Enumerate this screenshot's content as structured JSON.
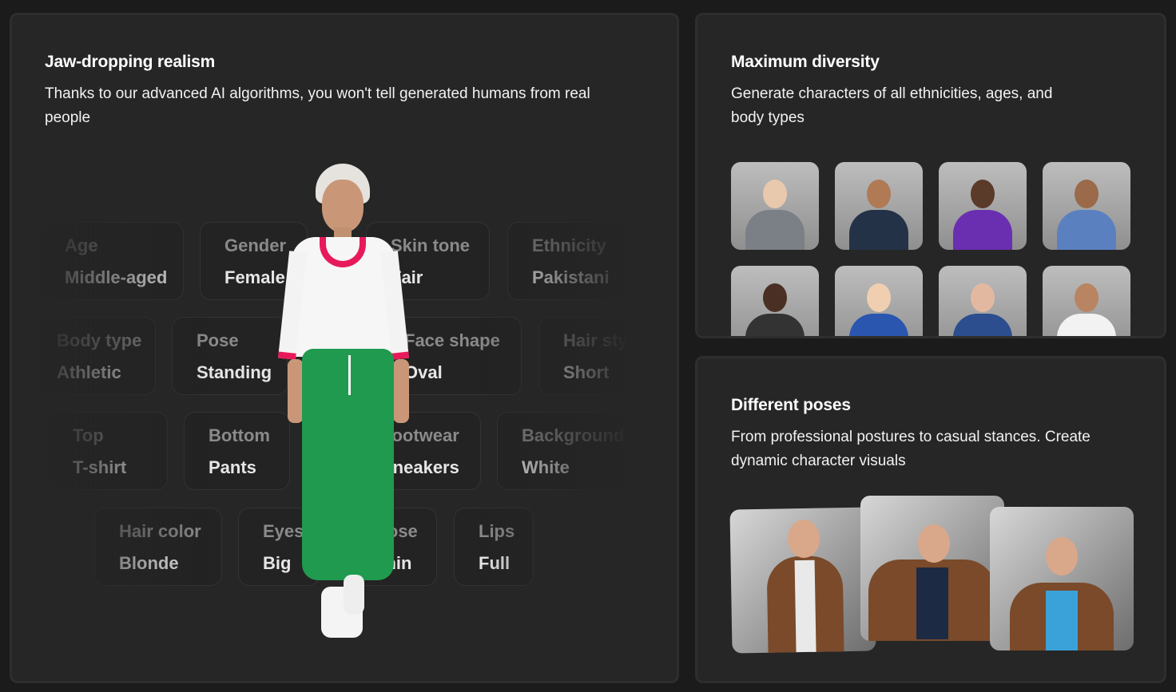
{
  "realism": {
    "title": "Jaw-dropping realism",
    "description": "Thanks to our advanced AI algorithms, you won't tell generated humans from real people",
    "chips": [
      {
        "key": "Age",
        "value": "Middle-aged"
      },
      {
        "key": "Gender",
        "value": "Female"
      },
      {
        "key": "Skin tone",
        "value": "Fair"
      },
      {
        "key": "Ethnicity",
        "value": "Pakistani"
      },
      {
        "key": "Body type",
        "value": "Athletic"
      },
      {
        "key": "Pose",
        "value": "Standing"
      },
      {
        "key": "Face shape",
        "value": "Oval"
      },
      {
        "key": "Hair style",
        "value": "Short"
      },
      {
        "key": "Top",
        "value": "T-shirt"
      },
      {
        "key": "Bottom",
        "value": "Pants"
      },
      {
        "key": "Footwear",
        "value": "Sneakers"
      },
      {
        "key": "Background",
        "value": "White"
      },
      {
        "key": "Hair color",
        "value": "Blonde"
      },
      {
        "key": "Eyes",
        "value": "Big"
      },
      {
        "key": "Nose",
        "value": "Thin"
      },
      {
        "key": "Lips",
        "value": "Full"
      }
    ]
  },
  "diversity": {
    "title": "Maximum diversity",
    "description": "Generate characters of all ethnicities, ages, and body types",
    "portraits": [
      {
        "skin": "#e8c9ad",
        "top": "#7b7f86"
      },
      {
        "skin": "#b07a55",
        "top": "#243247"
      },
      {
        "skin": "#5a3a28",
        "top": "#6a2fb0"
      },
      {
        "skin": "#9a6a4a",
        "top": "#5a80c0"
      },
      {
        "skin": "#4a3024",
        "top": "#333"
      },
      {
        "skin": "#f0cfb0",
        "top": "#2a56b0"
      },
      {
        "skin": "#e2b9a0",
        "top": "#2c4e8e"
      },
      {
        "skin": "#b98462",
        "top": "#f2f2f2"
      }
    ]
  },
  "poses": {
    "title": "Different poses",
    "description": "From professional postures to casual stances. Create dynamic character visuals"
  },
  "colors": {
    "page": "#1b1b1b",
    "card": "#262626",
    "border": "#2e2e2e"
  }
}
